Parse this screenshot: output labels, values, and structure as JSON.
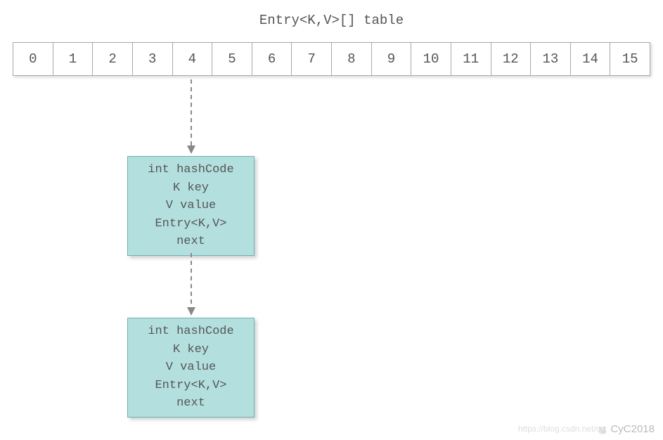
{
  "title": "Entry<K,V>[] table",
  "array": {
    "cells": [
      "0",
      "1",
      "2",
      "3",
      "4",
      "5",
      "6",
      "7",
      "8",
      "9",
      "10",
      "11",
      "12",
      "13",
      "14",
      "15"
    ],
    "linked_index": 4
  },
  "entry_fields": [
    "int hashCode",
    "K key",
    "V value",
    "Entry<K,V>",
    "next"
  ],
  "watermark": {
    "url": "https://blog.csdn.net/ng",
    "author": "CyC2018"
  },
  "colors": {
    "entry_bg": "#b3e0df",
    "entry_border": "#6db3b3",
    "text": "#555555",
    "cell_border": "#a8a8a8"
  }
}
